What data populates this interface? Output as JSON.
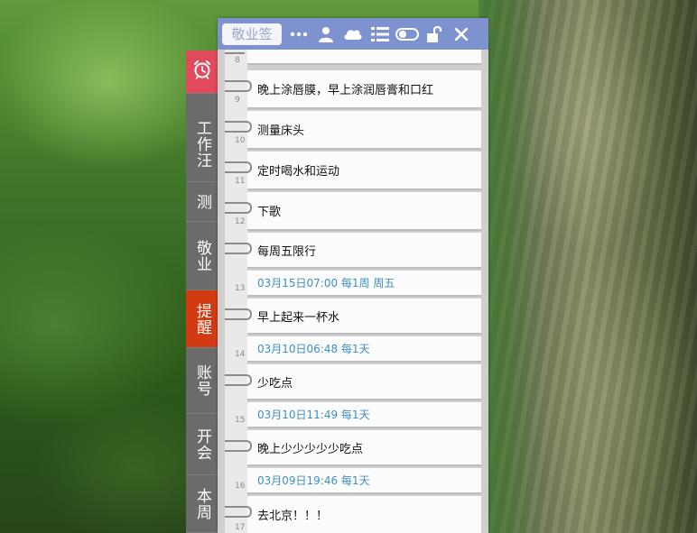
{
  "toolbar": {
    "label": "敬业签",
    "icons": [
      "more-icon",
      "user-icon",
      "cloud-icon",
      "list-icon",
      "toggle-icon",
      "lock-icon",
      "close-icon"
    ],
    "accent": "#7e92cf"
  },
  "sidebar": {
    "items": [
      {
        "label": "",
        "icon": "alarm-clock-icon"
      },
      {
        "label": "工作汪"
      },
      {
        "label": "测"
      },
      {
        "label": "敬业"
      },
      {
        "label": "提醒"
      },
      {
        "label": "账号"
      },
      {
        "label": "开会"
      },
      {
        "label": "本周"
      }
    ],
    "active_color": "#d23b12",
    "alarm_color": "#e04a5c"
  },
  "notes": [
    {
      "num": "8",
      "text": "…"
    },
    {
      "num": "9",
      "text": "晚上涂唇膜，早上涂润唇膏和口红"
    },
    {
      "num": "10",
      "text": "测量床头"
    },
    {
      "num": "11",
      "text": "定时喝水和运动"
    },
    {
      "num": "12",
      "text": "下歌"
    },
    {
      "num": "13",
      "text": "每周五限行",
      "reminder": "03月15日07:00 每1周 周五"
    },
    {
      "num": "14",
      "text": "早上起来一杯水",
      "reminder": "03月10日06:48 每1天"
    },
    {
      "num": "15",
      "text": "少吃点",
      "reminder": "03月10日11:49 每1天"
    },
    {
      "num": "16",
      "text": "晚上少少少少少吃点",
      "reminder": "03月09日19:46 每1天"
    },
    {
      "num": "17",
      "text": "去北京！！！"
    }
  ]
}
